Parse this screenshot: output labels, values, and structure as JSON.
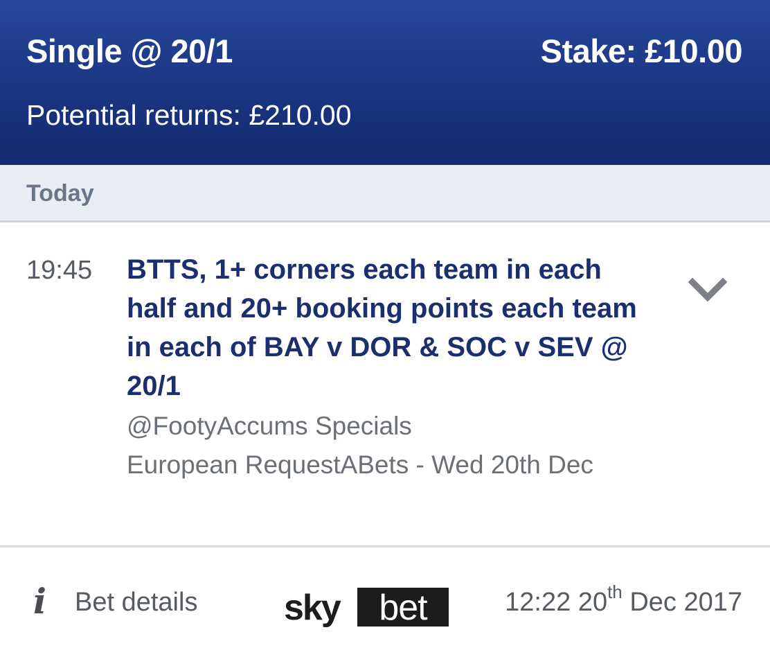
{
  "header": {
    "bet_type": "Single @ 20/1",
    "stake": "Stake: £10.00",
    "potential_returns": "Potential returns: £210.00"
  },
  "day_label": "Today",
  "selection": {
    "time": "19:45",
    "title": "BTTS, 1+ corners each team in each half and 20+ booking points each team in each of BAY v DOR & SOC v SEV @ 20/1",
    "market_line1": "@FootyAccums Specials",
    "market_line2": "European RequestABets - Wed 20th Dec",
    "expand_icon": "chevron-down-icon"
  },
  "footer": {
    "info_icon_glyph": "i",
    "bet_details_label": "Bet details",
    "logo_sky": "sky",
    "logo_bet": "bet",
    "timestamp_time": "12:22 20",
    "timestamp_suffix": "th",
    "timestamp_rest": " Dec 2017"
  },
  "colors": {
    "header_bg": "#1c3582",
    "title_text": "#1b2f6e",
    "day_bar_bg": "#e9edf3"
  }
}
